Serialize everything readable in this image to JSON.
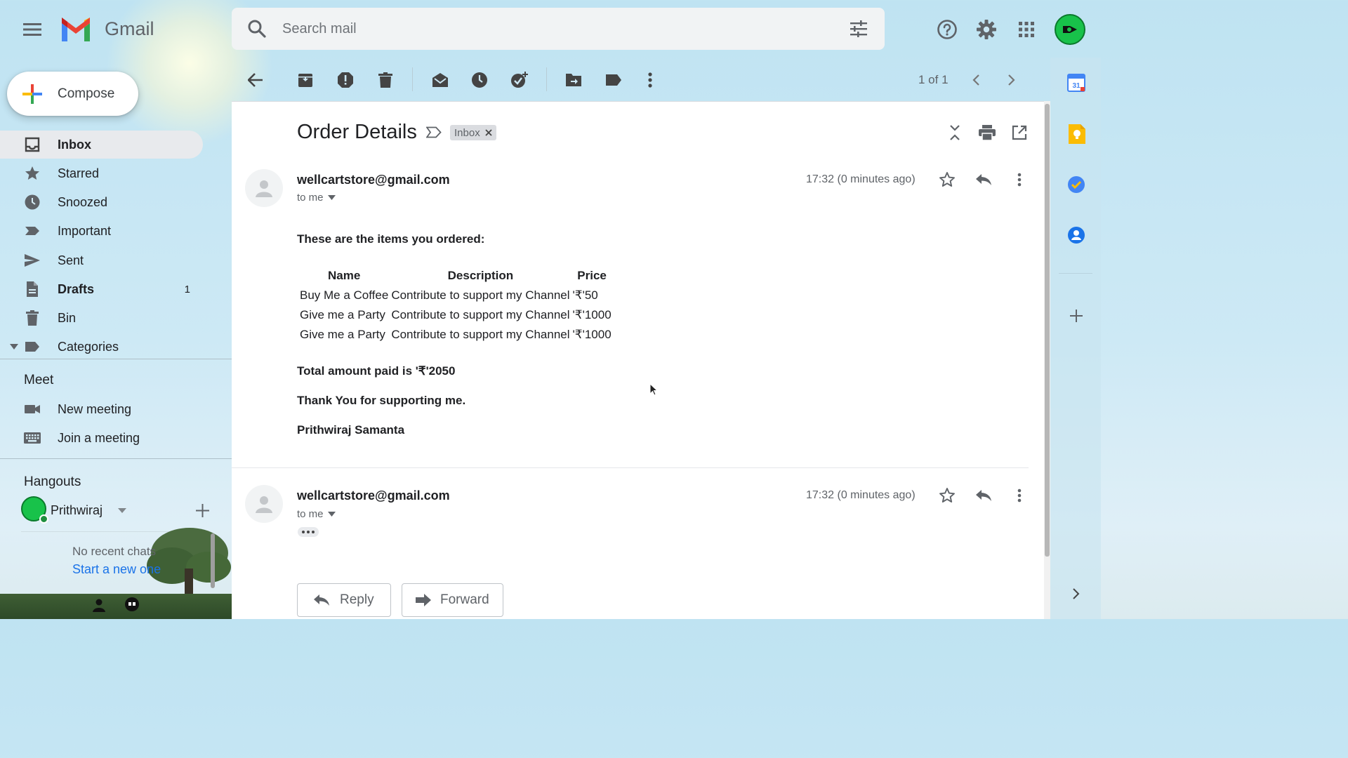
{
  "app": {
    "name": "Gmail"
  },
  "search": {
    "placeholder": "Search mail"
  },
  "compose": {
    "label": "Compose"
  },
  "sidebar": {
    "items": [
      {
        "label": "Inbox",
        "count": ""
      },
      {
        "label": "Starred",
        "count": ""
      },
      {
        "label": "Snoozed",
        "count": ""
      },
      {
        "label": "Important",
        "count": ""
      },
      {
        "label": "Sent",
        "count": ""
      },
      {
        "label": "Drafts",
        "count": "1"
      },
      {
        "label": "Bin",
        "count": ""
      },
      {
        "label": "Categories",
        "count": ""
      }
    ]
  },
  "meet": {
    "title": "Meet",
    "new_meeting": "New meeting",
    "join_meeting": "Join a meeting"
  },
  "hangouts": {
    "title": "Hangouts",
    "user": "Prithwiraj",
    "no_recent": "No recent chats",
    "start_new": "Start a new one"
  },
  "toolbar": {
    "pagination": "1 of 1"
  },
  "thread": {
    "subject": "Order Details",
    "label_chip": "Inbox",
    "messages": [
      {
        "sender": "wellcartstore@gmail.com",
        "recipient": "to me",
        "time": "17:32 (0 minutes ago)"
      },
      {
        "sender": "wellcartstore@gmail.com",
        "recipient": "to me",
        "time": "17:32 (0 minutes ago)"
      }
    ],
    "intro": "These are the items you ordered:",
    "table": {
      "headers": [
        "Name",
        "Description",
        "Price"
      ],
      "rows": [
        [
          "Buy Me a Coffee",
          "Contribute to support my Channel",
          "'₹'50"
        ],
        [
          "Give me a Party",
          "Contribute to support my Channel",
          "'₹'1000"
        ],
        [
          "Give me a Party",
          "Contribute to support my Channel",
          "'₹'1000"
        ]
      ]
    },
    "total": "Total amount paid is '₹'2050",
    "thanks": "Thank You for supporting me.",
    "signature": "Prithwiraj Samanta"
  },
  "actions": {
    "reply": "Reply",
    "forward": "Forward"
  },
  "colors": {
    "accent_red": "#ea4335",
    "accent_blue": "#4285f4",
    "accent_green": "#34a853",
    "accent_yellow": "#fbbc04"
  }
}
